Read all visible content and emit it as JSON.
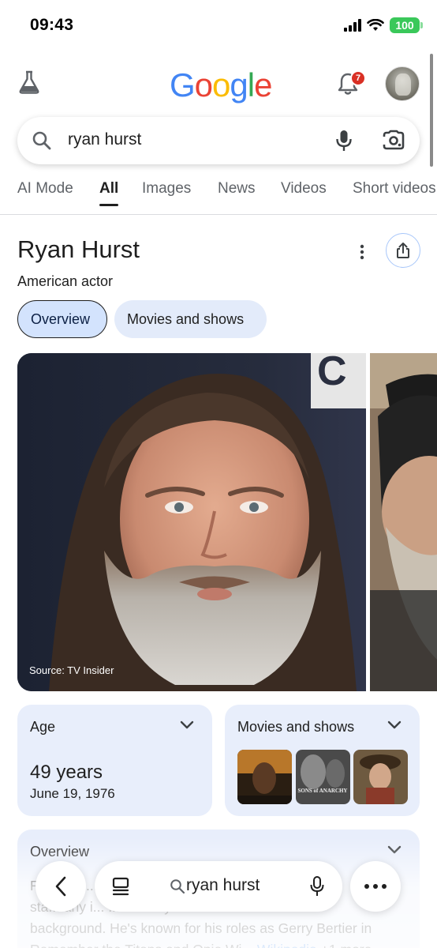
{
  "status_bar": {
    "time": "09:43",
    "battery": "100"
  },
  "header": {
    "logo_letters": [
      "G",
      "o",
      "o",
      "g",
      "l",
      "e"
    ],
    "logo_colors": [
      "#4285F4",
      "#EA4335",
      "#FBBC05",
      "#4285F4",
      "#34A853",
      "#EA4335"
    ],
    "notification_count": "7"
  },
  "search": {
    "query": "ryan hurst"
  },
  "tabs": [
    {
      "label": "AI Mode",
      "active": false
    },
    {
      "label": "All",
      "active": true
    },
    {
      "label": "Images",
      "active": false
    },
    {
      "label": "News",
      "active": false
    },
    {
      "label": "Videos",
      "active": false
    },
    {
      "label": "Short videos",
      "active": false
    }
  ],
  "knowledge_panel": {
    "title": "Ryan Hurst",
    "subtitle": "American actor",
    "chips": [
      "Overview",
      "Movies and shows"
    ],
    "image_source": "Source: TV Insider",
    "age_card": {
      "label": "Age",
      "value": "49 years",
      "date": "June 19, 1976"
    },
    "movies_card": {
      "label": "Movies and shows",
      "poster_2_caption": "SONS of ANARCHY"
    },
    "overview_card": {
      "label": "Overview",
      "text_line_1": "R... ug... ... go",
      "text_line_2": "sta... arly i... ...ood ...ily",
      "text_line_3": "background. He's known for his roles as Gerry Bertier in",
      "text_line_4": "Remember the Titans and Opie Wi...",
      "wiki_link": "Wikipedia",
      "more_link": "+1 more"
    }
  },
  "bottom_bar": {
    "query": "ryan hurst"
  },
  "colors": {
    "accent": "#1a73e8",
    "chip_selected": "#d3e3fd",
    "card_bg": "#e8eefb",
    "badge": "#d93025"
  }
}
